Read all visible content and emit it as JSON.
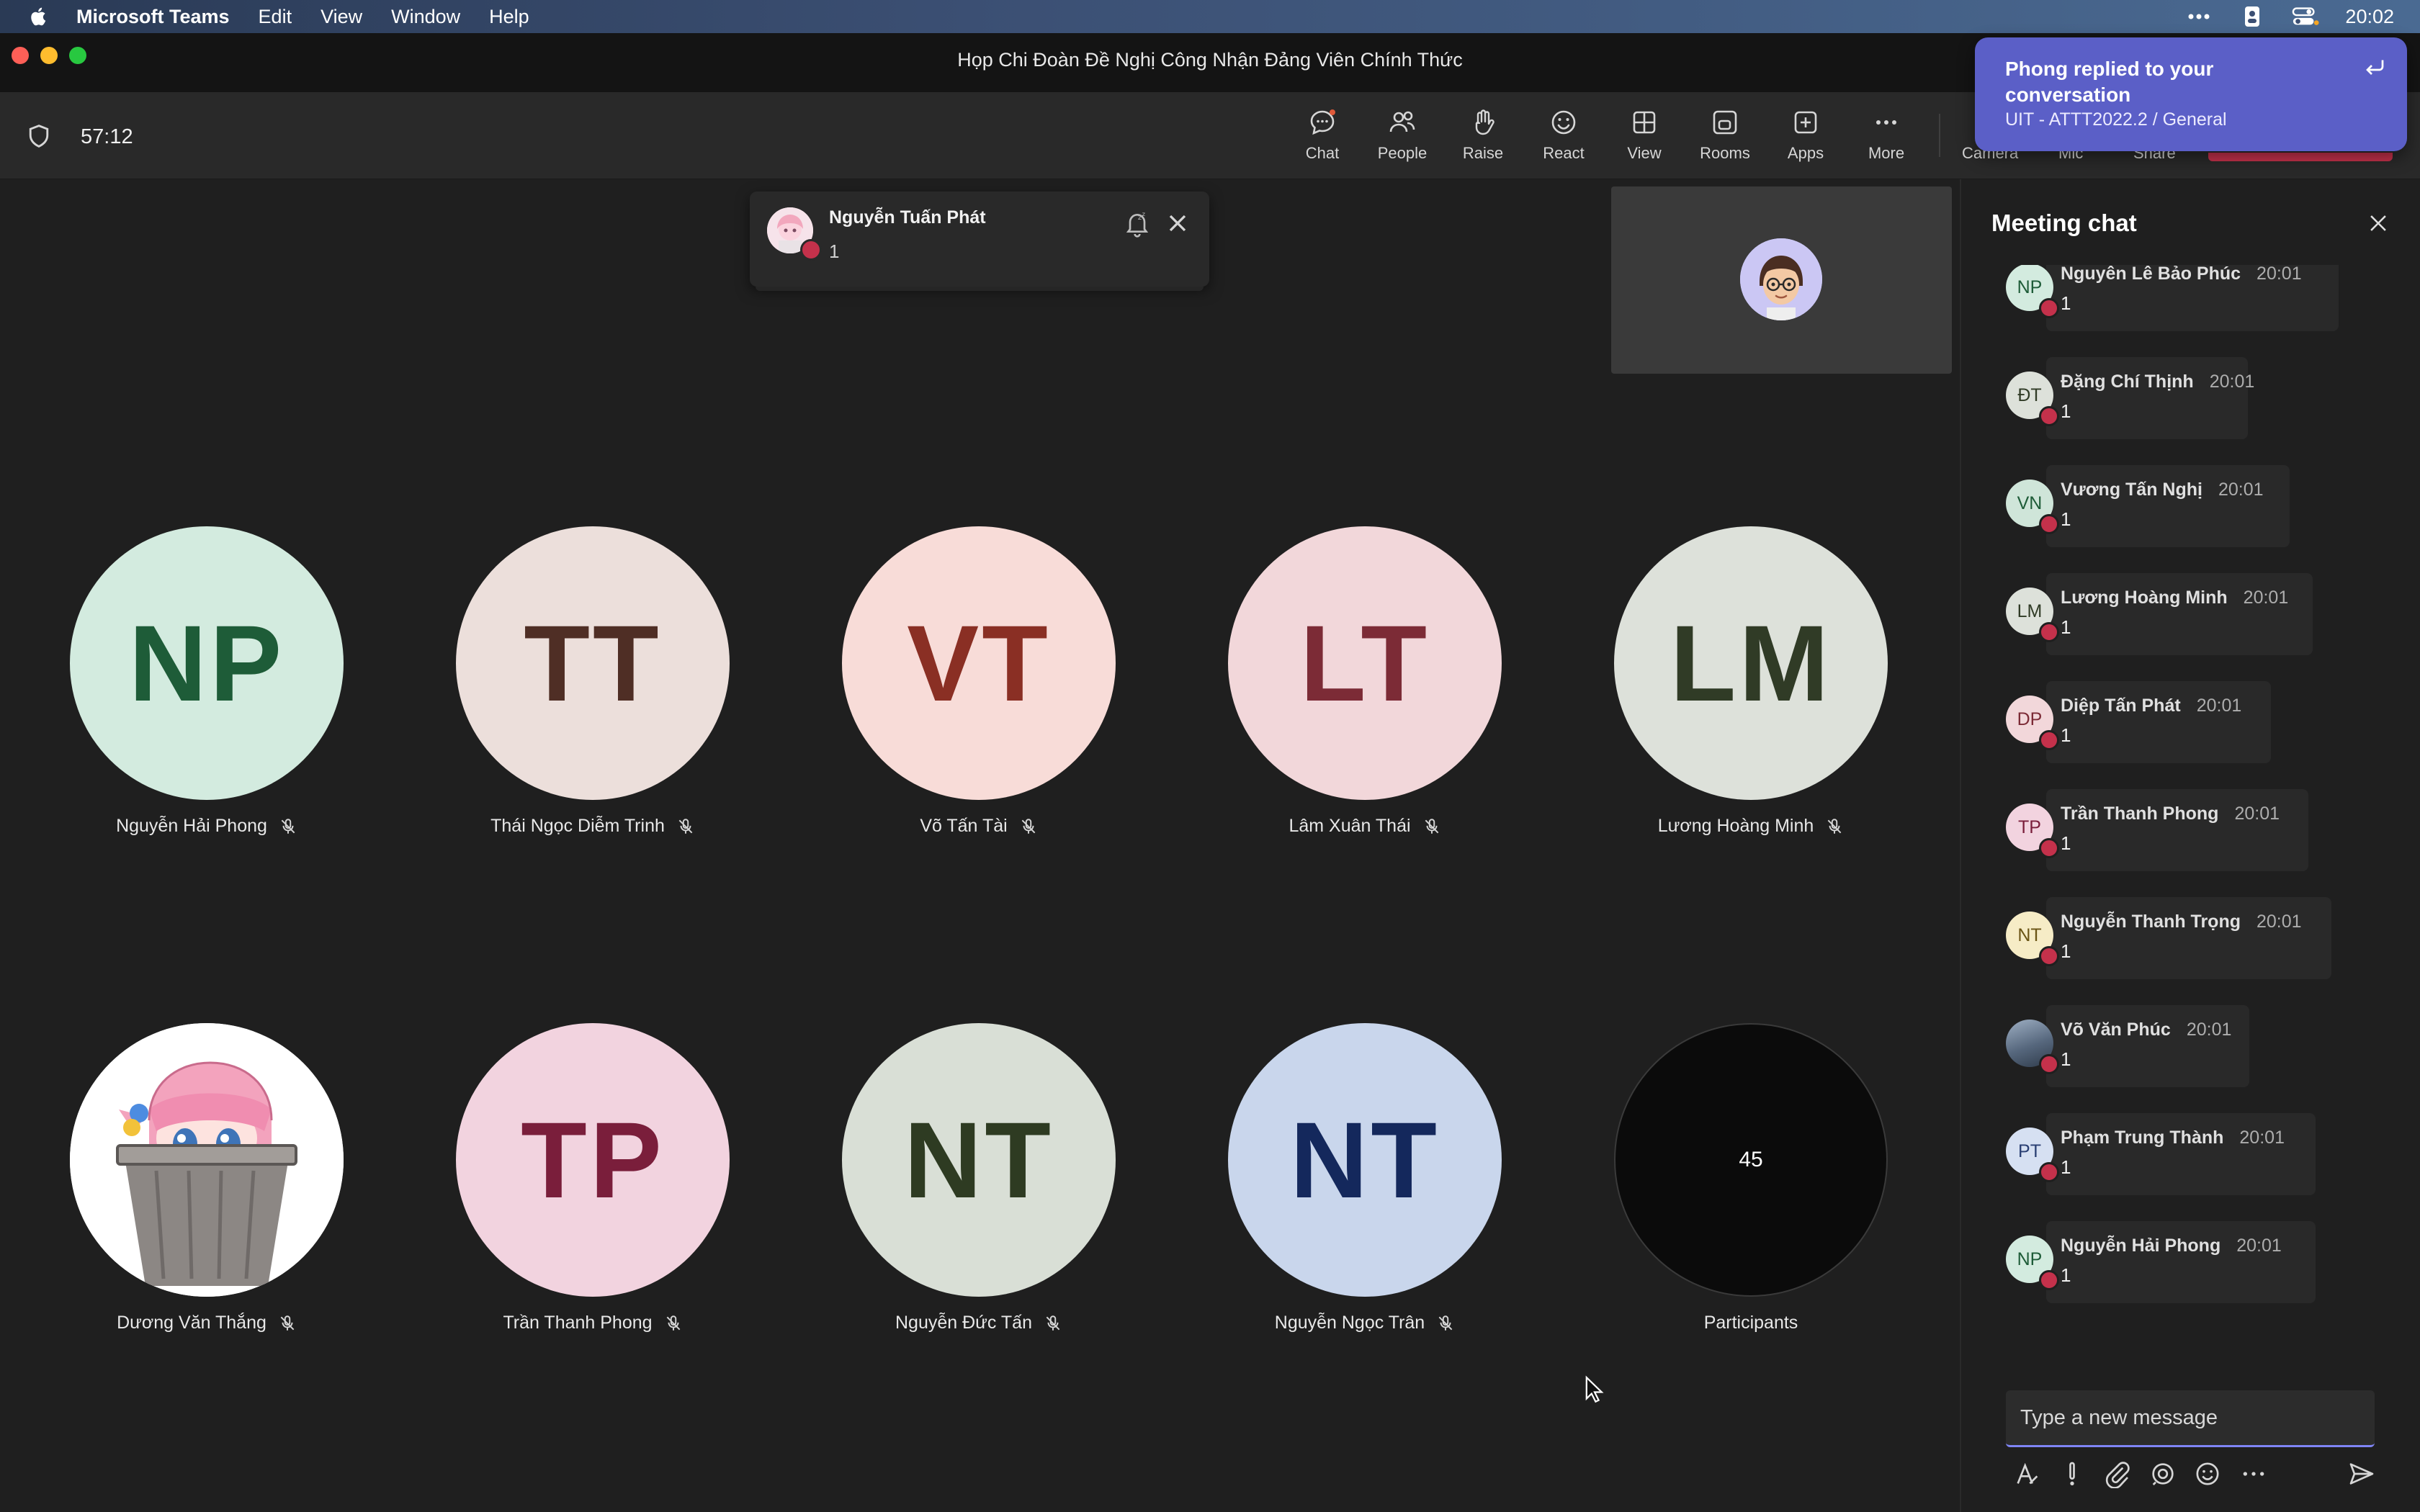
{
  "menubar": {
    "app_name": "Microsoft Teams",
    "items": [
      "Edit",
      "View",
      "Window",
      "Help"
    ],
    "clock": "20:02"
  },
  "window": {
    "title": "Họp Chi Đoàn Đề Nghị Công Nhận Đảng Viên Chính Thức"
  },
  "toolbar": {
    "timer": "57:12",
    "buttons": [
      {
        "label": "Chat",
        "icon": "chat-icon"
      },
      {
        "label": "People",
        "icon": "people-icon"
      },
      {
        "label": "Raise",
        "icon": "raise-hand-icon"
      },
      {
        "label": "React",
        "icon": "react-icon"
      },
      {
        "label": "View",
        "icon": "view-grid-icon"
      },
      {
        "label": "Rooms",
        "icon": "rooms-icon"
      },
      {
        "label": "Apps",
        "icon": "apps-icon"
      },
      {
        "label": "More",
        "icon": "more-icon"
      }
    ],
    "partially_visible": [
      "Camera",
      "Mic",
      "Share"
    ]
  },
  "notification": {
    "title": "Phong replied to your conversation",
    "subtitle": "UIT - ATTT2022.2 / General"
  },
  "speaker_card": {
    "name": "Nguyễn Tuấn Phát",
    "message": "1"
  },
  "participants": [
    {
      "initials": "NP",
      "name": "Nguyễn Hải Phong",
      "bg": "#d3ebdf",
      "fg": "#1e5c38"
    },
    {
      "initials": "TT",
      "name": "Thái Ngọc Diễm Trinh",
      "bg": "#ecdfdb",
      "fg": "#4f2e25"
    },
    {
      "initials": "VT",
      "name": "Võ Tấn Tài",
      "bg": "#f8dcd8",
      "fg": "#8a2f24"
    },
    {
      "initials": "LT",
      "name": "Lâm Xuân Thái",
      "bg": "#f2d7da",
      "fg": "#7c2b36"
    },
    {
      "initials": "LM",
      "name": "Lương Hoàng Minh",
      "bg": "#dde1da",
      "fg": "#303b26"
    },
    {
      "initials": "",
      "name": "Dương Văn Thắng",
      "bg": "#ffffff",
      "fg": "#000000",
      "avatar": "anime-picture"
    },
    {
      "initials": "TP",
      "name": "Trần Thanh Phong",
      "bg": "#f2d3df",
      "fg": "#7a1e3b"
    },
    {
      "initials": "NT",
      "name": "Nguyễn Đức Tấn",
      "bg": "#d9dfd6",
      "fg": "#2e3b22"
    },
    {
      "initials": "NT",
      "name": "Nguyễn Ngọc Trân",
      "bg": "#c9d6ec",
      "fg": "#14285c"
    }
  ],
  "overflow_tile": {
    "count": "45",
    "label": "Participants"
  },
  "chat": {
    "title": "Meeting chat",
    "messages": [
      {
        "initials": "NP",
        "name": "Nguyên Lê Bảo Phúc",
        "time": "20:01",
        "text": "1",
        "bg": "#d3ebdf",
        "fg": "#1e5c38"
      },
      {
        "initials": "ĐT",
        "name": "Đặng Chí Thịnh",
        "time": "20:01",
        "text": "1",
        "bg": "#dde1da",
        "fg": "#303b26"
      },
      {
        "initials": "VN",
        "name": "Vương Tấn Nghị",
        "time": "20:01",
        "text": "1",
        "bg": "#cfe5d9",
        "fg": "#1e5c38"
      },
      {
        "initials": "LM",
        "name": "Lương Hoàng Minh",
        "time": "20:01",
        "text": "1",
        "bg": "#dde1da",
        "fg": "#303b26"
      },
      {
        "initials": "DP",
        "name": "Diệp Tấn Phát",
        "time": "20:01",
        "text": "1",
        "bg": "#f2d7da",
        "fg": "#7c2b36"
      },
      {
        "initials": "TP",
        "name": "Trần Thanh Phong",
        "time": "20:01",
        "text": "1",
        "bg": "#f2d3df",
        "fg": "#7a1e3b"
      },
      {
        "initials": "NT",
        "name": "Nguyễn Thanh Trọng",
        "time": "20:01",
        "text": "1",
        "bg": "#f6ecc6",
        "fg": "#6a5414"
      },
      {
        "initials": "",
        "name": "Võ Văn Phúc",
        "time": "20:01",
        "text": "1",
        "bg": "#6b7a8c",
        "fg": "#ffffff",
        "avatar": "photo"
      },
      {
        "initials": "PT",
        "name": "Phạm Trung Thành",
        "time": "20:01",
        "text": "1",
        "bg": "#d6e0f2",
        "fg": "#2a3f73"
      },
      {
        "initials": "NP",
        "name": "Nguyễn Hải Phong",
        "time": "20:01",
        "text": "1",
        "bg": "#d3ebdf",
        "fg": "#1e5c38"
      }
    ],
    "compose_placeholder": "Type a new message"
  },
  "colors": {
    "accent": "#5b5fc7",
    "presence_busy": "#c4314b"
  }
}
